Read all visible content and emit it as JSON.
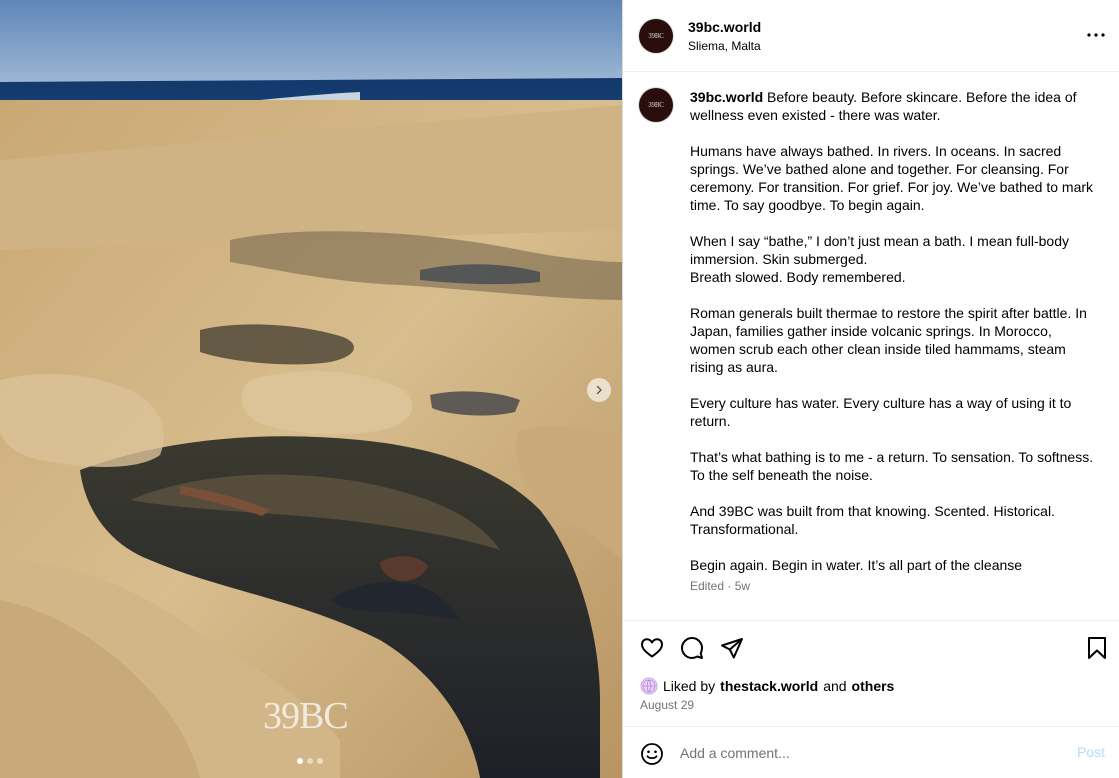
{
  "post": {
    "username": "39bc.world",
    "location": "Sliema, Malta",
    "avatar_text": "39BC",
    "watermark_text": "39BC",
    "slide_count": 3,
    "active_slide": 1
  },
  "caption": {
    "username": "39bc.world",
    "paragraphs": [
      "Before beauty. Before skincare. Before the idea of wellness even existed - there was water.",
      "Humans have always bathed. In rivers. In oceans. In sacred springs. We’ve bathed alone and together. For cleansing. For ceremony. For transition. For grief. For joy. We’ve bathed to mark time. To say goodbye. To begin again.",
      "When I say “bathe,” I don’t just mean a bath. I mean full-body immersion. Skin submerged.\nBreath slowed. Body remembered.",
      "Roman generals built thermae to restore the spirit after battle. In Japan, families gather inside volcanic springs. In Morocco, women scrub each other clean inside tiled hammams, steam rising as aura.",
      "Every culture has water. Every culture has a way of using it to return.",
      "That’s what bathing is to me - a return. To sensation. To softness. To the self beneath the noise.",
      "And 39BC was built from that knowing. Scented. Historical. Transformational.",
      "Begin again. Begin in water. It’s all part of the cleanse"
    ],
    "meta": "Edited · 5w"
  },
  "likes": {
    "prefix": "Liked by",
    "user": "thestack.world",
    "and": "and",
    "others": "others"
  },
  "date": "August 29",
  "comment": {
    "placeholder": "Add a comment...",
    "post_label": "Post"
  },
  "icons": {
    "more": "more-options-icon",
    "like": "heart-icon",
    "comment": "comment-bubble-icon",
    "share": "paper-plane-icon",
    "save": "bookmark-icon",
    "emoji": "smiley-icon",
    "next": "chevron-right-icon"
  },
  "colors": {
    "accent_disabled": "#b3dbff",
    "secondary_text": "#737373",
    "avatar_bg": "#2a0e0d",
    "border": "#dbdbdb"
  }
}
